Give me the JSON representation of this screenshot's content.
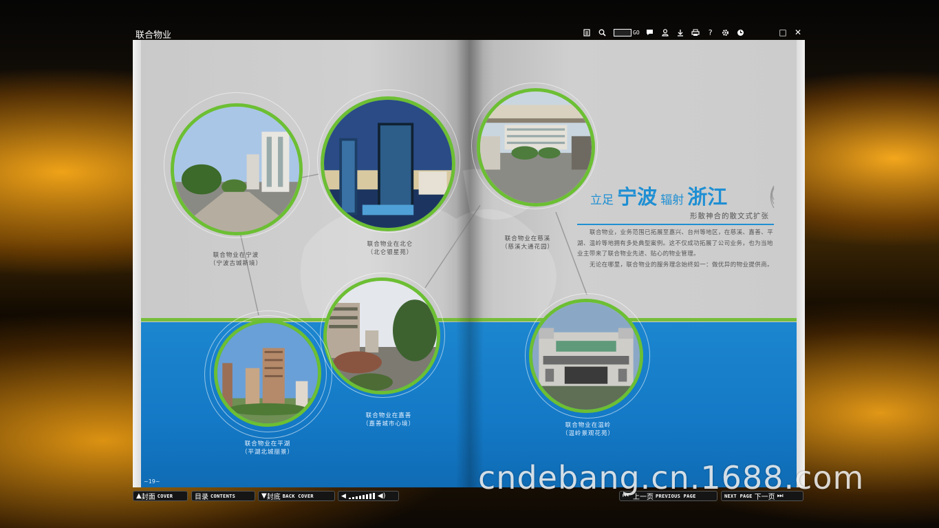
{
  "window": {
    "title": "联合物业",
    "toolbar_icons": [
      "thumbnails-icon",
      "zoom-icon",
      "page-input",
      "share-icon",
      "user-icon",
      "download-icon",
      "print-icon",
      "help-icon",
      "settings-icon",
      "autoflip-icon"
    ],
    "goto_label": "GO",
    "maximize": "□",
    "close": "✕"
  },
  "spread": {
    "headline": {
      "part1": "立足",
      "part2": "宁波",
      "part3": "辐射",
      "part4": "浙江"
    },
    "subheading": "形散神合的散文式扩张",
    "paragraph1": "联合物业，业务范围已拓展至嘉兴、台州等地区，在慈溪、嘉善、平湖、温岭等地拥有多处典型案例。这不仅成功拓展了公司业务，也为当地业主带来了联合物业先进、贴心的物业管理。",
    "paragraph2": "无论在哪里，联合物业的服务理念始终如一：做优异的物业提供商。",
    "page_number": "~19~",
    "captions": [
      {
        "line1": "联合物业在宁波",
        "line2": "（宁波古城新境）"
      },
      {
        "line1": "联合物业在北仑",
        "line2": "（北仑银星苑）"
      },
      {
        "line1": "联合物业在慈溪",
        "line2": "（慈溪大通花园）"
      },
      {
        "line1": "联合物业在嘉善",
        "line2": "（嘉善城市心境）"
      },
      {
        "line1": "联合物业在平湖",
        "line2": "（平湖北城丽景）"
      },
      {
        "line1": "联合物业在温岭",
        "line2": "（温岭景观花苑）"
      }
    ]
  },
  "controls": {
    "cover": {
      "cn": "封面",
      "en": "COVER"
    },
    "contents": {
      "cn": "目录",
      "en": "CONTENTS"
    },
    "back_cover": {
      "cn": "封底",
      "en": "BACK COVER"
    },
    "prev": {
      "cn": "上一页",
      "en": "PREVIOUS PAGE"
    },
    "next": {
      "cn": "下一页",
      "en": "NEXT PAGE"
    },
    "volume_level": 0.8
  },
  "watermark": "cndebang.cn.1688.com",
  "colors": {
    "accent_blue": "#1f8fd3",
    "accent_green": "#6cbf33",
    "band_blue": "#1479c6"
  }
}
